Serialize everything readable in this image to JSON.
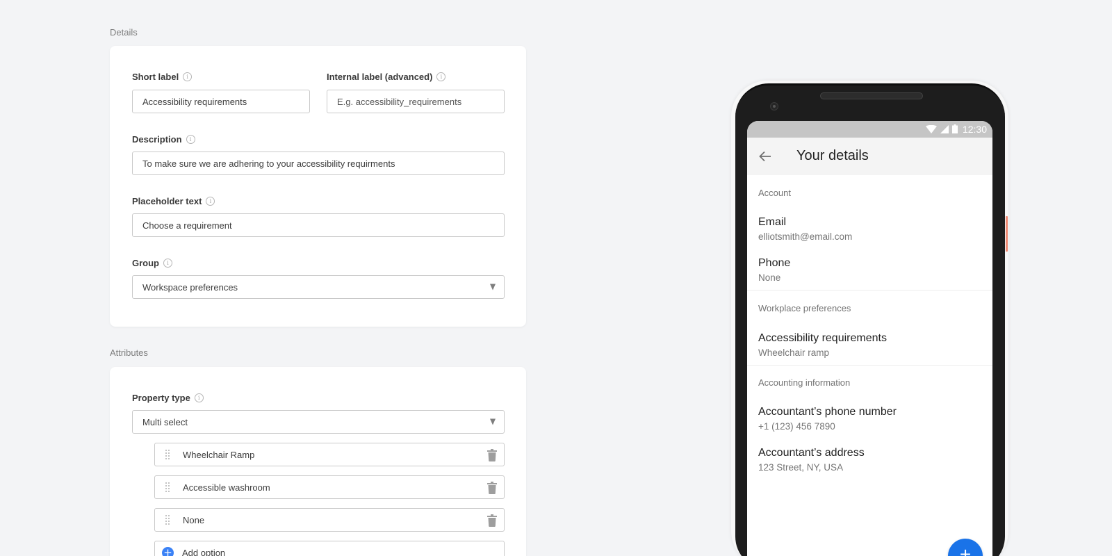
{
  "details": {
    "section_title": "Details",
    "short_label": {
      "label": "Short label",
      "value": "Accessibility requirements"
    },
    "internal_label": {
      "label": "Internal label (advanced)",
      "placeholder": "E.g. accessibility_requirements"
    },
    "description": {
      "label": "Description",
      "value": "To make sure we are adhering to your accessibility requirments"
    },
    "placeholder_text": {
      "label": "Placeholder text",
      "value": "Choose a requirement"
    },
    "group": {
      "label": "Group",
      "selected": "Workspace preferences"
    }
  },
  "attributes": {
    "section_title": "Attributes",
    "property_type": {
      "label": "Property type",
      "selected": "Multi select"
    },
    "options": [
      {
        "label": "Wheelchair Ramp"
      },
      {
        "label": "Accessible washroom"
      },
      {
        "label": "None"
      }
    ],
    "add_option_label": "Add option"
  },
  "icons": {
    "info": "i",
    "add": "+"
  },
  "phone": {
    "status_time": "12:30",
    "app_title": "Your details",
    "sections": [
      {
        "header": "Account",
        "items": [
          {
            "title": "Email",
            "subtitle": "elliotsmith@email.com"
          },
          {
            "title": "Phone",
            "subtitle": "None"
          }
        ]
      },
      {
        "header": "Workplace preferences",
        "items": [
          {
            "title": "Accessibility requirements",
            "subtitle": "Wheelchair ramp"
          }
        ]
      },
      {
        "header": "Accounting information",
        "items": [
          {
            "title": "Accountant’s phone number",
            "subtitle": "+1 (123) 456 7890"
          },
          {
            "title": "Accountant’s address",
            "subtitle": "123 Street, NY, USA"
          }
        ]
      }
    ],
    "fab_label": "+"
  },
  "colors": {
    "background": "#f3f4f6",
    "accent_blue": "#1a73e8",
    "add_icon_blue": "#3b82f6",
    "phone_body": "#1d1d1d",
    "side_button": "#ef8a73"
  }
}
